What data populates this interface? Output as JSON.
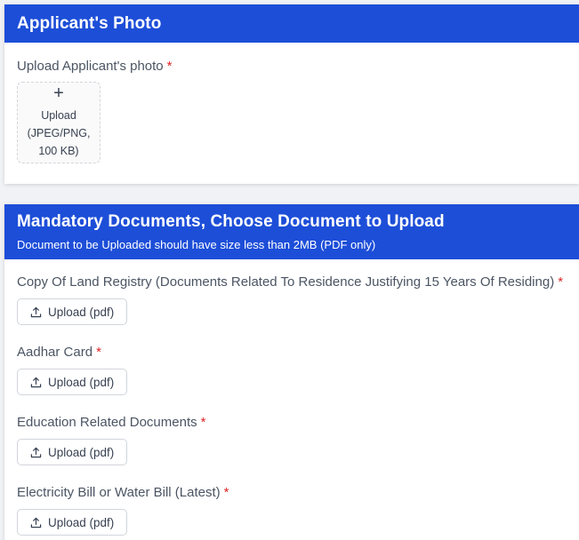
{
  "photo_section": {
    "title": "Applicant's Photo",
    "field_label": "Upload Applicant's photo",
    "required_mark": "*",
    "upload_icon": "plus-icon",
    "upload_plus": "+",
    "upload_lines": [
      "Upload",
      "(JPEG/PNG,",
      "100 KB)"
    ]
  },
  "documents_section": {
    "title": "Mandatory Documents, Choose Document to Upload",
    "subtitle": "Document to be Uploaded should have size less than 2MB (PDF only)",
    "required_mark": "*",
    "button_icon": "upload-icon",
    "fields": [
      {
        "label": "Copy Of Land Registry (Documents Related To Residence Justifying 15 Years Of Residing)",
        "button_label": "Upload (pdf)"
      },
      {
        "label": "Aadhar Card",
        "button_label": "Upload (pdf)"
      },
      {
        "label": "Education Related Documents",
        "button_label": "Upload (pdf)"
      },
      {
        "label": "Electricity Bill or Water Bill (Latest)",
        "button_label": "Upload (pdf)"
      }
    ]
  },
  "colors": {
    "header_bg": "#1d4ed8",
    "required": "#dc2626",
    "page_bg": "#f0f2f5"
  }
}
